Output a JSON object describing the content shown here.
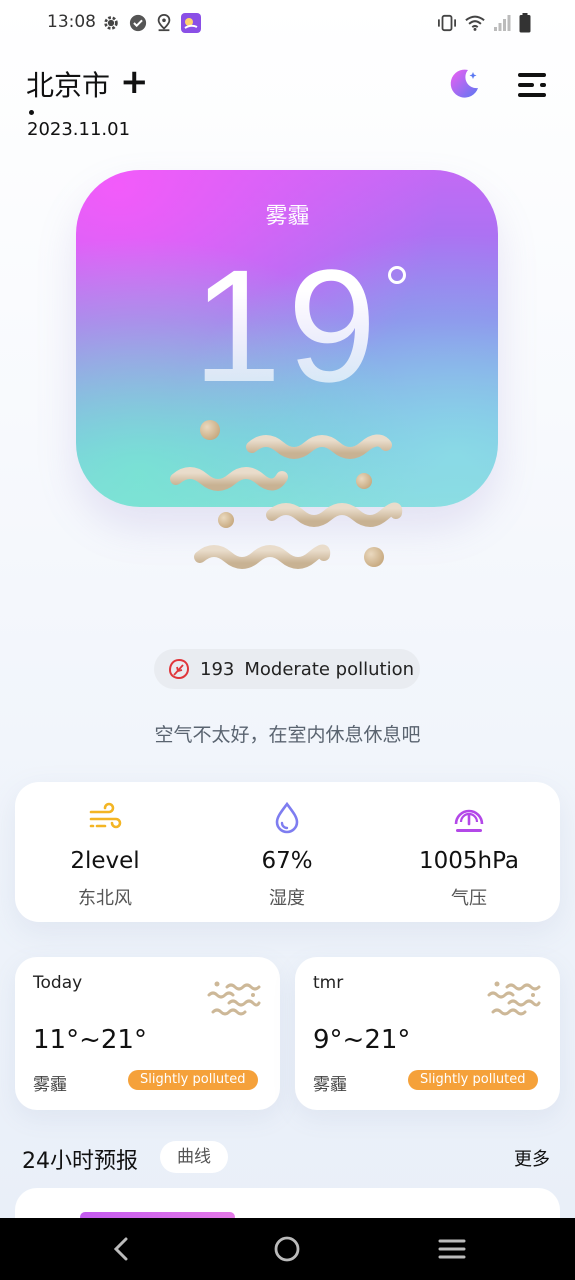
{
  "status_bar": {
    "time": "13:08",
    "left_icons": [
      "gear-icon",
      "check-circle-icon",
      "location-icon",
      "app-icon"
    ],
    "right_icons": [
      "vibrate-icon",
      "wifi-icon",
      "signal-icon",
      "battery-icon"
    ]
  },
  "header": {
    "city": "北京市",
    "add_label": "+",
    "date": "2023.11.01",
    "theme_icon": "moon-icon",
    "menu_icon": "menu-icon"
  },
  "hero": {
    "condition": "雾霾",
    "temperature": "19",
    "degree_symbol": "°",
    "colors": {
      "top": "#f35cf7",
      "middle": "#8f7cf0",
      "bottom": "#8ad9dc"
    }
  },
  "aqi": {
    "value": "193",
    "label": "Moderate pollution",
    "icon": "leaf-icon",
    "icon_color": "#e0363b"
  },
  "advice": "空气不太好，在室内休息休息吧",
  "stats": [
    {
      "value": "2level",
      "label": "东北风",
      "icon": "wind-icon",
      "color": "#f3b524"
    },
    {
      "value": "67%",
      "label": "湿度",
      "icon": "drop-icon",
      "color": "#7e7df0"
    },
    {
      "value": "1005hPa",
      "label": "气压",
      "icon": "gauge-icon",
      "color": "#b348e8"
    }
  ],
  "days": [
    {
      "name": "Today",
      "range": "11°~21°",
      "condition": "雾霾",
      "badge": "Slightly polluted",
      "icon": "haze-icon"
    },
    {
      "name": "tmr",
      "range": "9°~21°",
      "condition": "雾霾",
      "badge": "Slightly polluted",
      "icon": "haze-icon"
    }
  ],
  "forecast": {
    "title": "24小时预报",
    "curve_label": "曲线",
    "more_label": "更多"
  },
  "nav": {
    "back_icon": "back-icon",
    "home_icon": "home-icon",
    "recents_icon": "recents-icon"
  }
}
